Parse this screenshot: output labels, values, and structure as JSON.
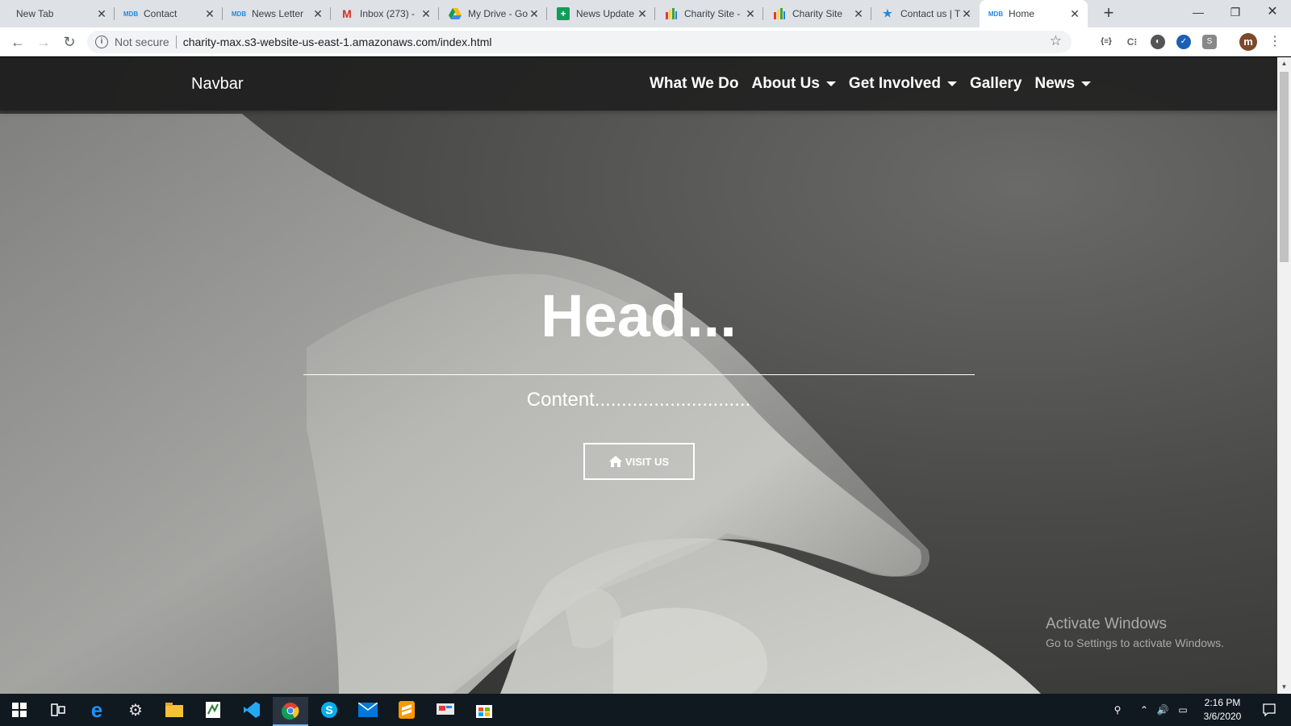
{
  "browser": {
    "tabs": [
      {
        "title": "New Tab",
        "icon": "none",
        "active": false
      },
      {
        "title": "Contact",
        "icon": "mdb",
        "active": false
      },
      {
        "title": "News Letter",
        "icon": "mdb",
        "active": false
      },
      {
        "title": "Inbox (273) -",
        "icon": "gmail",
        "active": false
      },
      {
        "title": "My Drive - Go",
        "icon": "drive",
        "active": false
      },
      {
        "title": "News Update",
        "icon": "sheets",
        "active": false
      },
      {
        "title": "Charity Site -",
        "icon": "charity",
        "active": false
      },
      {
        "title": "Charity Site",
        "icon": "charity",
        "active": false
      },
      {
        "title": "Contact us | T",
        "icon": "contact",
        "active": false
      },
      {
        "title": "Home",
        "icon": "mdb",
        "active": true
      }
    ],
    "new_tab_glyph": "+",
    "security_label": "Not secure",
    "url": "charity-max.s3-website-us-east-1.amazonaws.com/index.html",
    "avatar_letter": "m"
  },
  "site": {
    "brand": "Navbar",
    "nav": [
      {
        "label": "What We Do",
        "dropdown": false
      },
      {
        "label": "About Us",
        "dropdown": true
      },
      {
        "label": "Get Involved",
        "dropdown": true
      },
      {
        "label": "Gallery",
        "dropdown": false
      },
      {
        "label": "News",
        "dropdown": true
      }
    ],
    "hero": {
      "headline": "Head...",
      "subtext": "Content.............................",
      "button_label": "VISIT US"
    }
  },
  "watermark": {
    "line1": "Activate Windows",
    "line2": "Go to Settings to activate Windows."
  },
  "taskbar": {
    "time": "2:16 PM",
    "date": "3/6/2020"
  },
  "colors": {
    "navbar_bg": "#1e1e1e",
    "taskbar_bg": "#101820",
    "tabstrip_bg": "#dee1e6"
  }
}
